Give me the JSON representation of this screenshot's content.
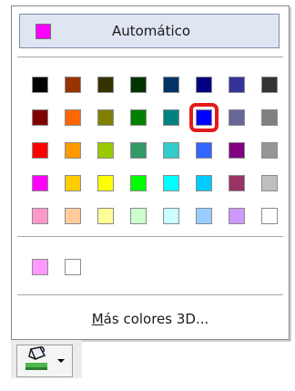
{
  "automatic": {
    "label": "Automático",
    "swatch_color": "#ff00ff"
  },
  "palette": [
    [
      "#000000",
      "#993300",
      "#333300",
      "#003300",
      "#003366",
      "#000080",
      "#333399",
      "#333333"
    ],
    [
      "#800000",
      "#ff6600",
      "#808000",
      "#008000",
      "#008080",
      "#0000ff",
      "#666699",
      "#808080"
    ],
    [
      "#ff0000",
      "#ff9900",
      "#99cc00",
      "#339966",
      "#33cccc",
      "#3366ff",
      "#800080",
      "#969696"
    ],
    [
      "#ff00ff",
      "#ffcc00",
      "#ffff00",
      "#00ff00",
      "#00ffff",
      "#00ccff",
      "#993366",
      "#c0c0c0"
    ],
    [
      "#ff99cc",
      "#ffcc99",
      "#ffff99",
      "#ccffcc",
      "#ccffff",
      "#99ccff",
      "#cc99ff",
      "#ffffff"
    ]
  ],
  "selected": {
    "row": 1,
    "col": 5,
    "highlight_color": "#e41a1a"
  },
  "recent_colors": [
    "#ff99ff",
    "#ffffff"
  ],
  "more_colors": {
    "underlined": "M",
    "rest": "ás colores 3D..."
  },
  "toolbar_button": {
    "icon": "fill-bucket-icon"
  }
}
